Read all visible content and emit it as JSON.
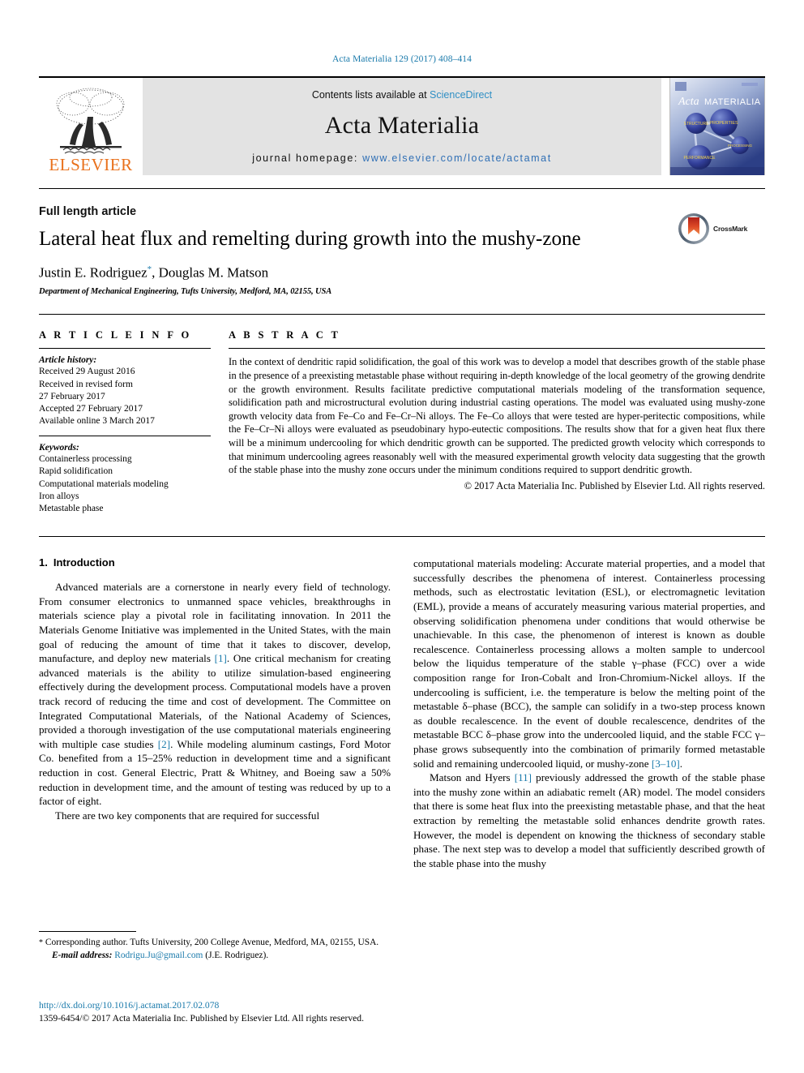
{
  "running_head": "Acta Materialia 129 (2017) 408–414",
  "banner": {
    "publisher_name": "ELSEVIER",
    "publisher_logo_icon": "elsevier-tree-icon",
    "contents_prefix": "Contents lists available at ",
    "contents_link": "ScienceDirect",
    "journal_title": "Acta Materialia",
    "homepage_prefix": "journal homepage: ",
    "homepage_url": "www.elsevier.com/locate/actamat",
    "cover_title_italic": "Acta",
    "cover_title_rest": "MATERIALIA",
    "cover_node_labels": [
      "STRUCTURE",
      "PROPERTIES",
      "PROCESSING",
      "PERFORMANCE"
    ]
  },
  "title_block": {
    "article_type": "Full length article",
    "title": "Lateral heat flux and remelting during growth into the mushy-zone",
    "authors_part1": "Justin E. Rodriguez",
    "author_star": "*",
    "authors_part2": ", Douglas M. Matson",
    "affiliation": "Department of Mechanical Engineering, Tufts University, Medford, MA, 02155, USA",
    "crossmark_label": "CrossMark"
  },
  "article_info": {
    "heading": "A R T I C L E   I N F O",
    "history_label": "Article history:",
    "history_lines": [
      "Received 29 August 2016",
      "Received in revised form",
      "27 February 2017",
      "Accepted 27 February 2017",
      "Available online 3 March 2017"
    ],
    "keywords_label": "Keywords:",
    "keywords": [
      "Containerless processing",
      "Rapid solidification",
      "Computational materials modeling",
      "Iron alloys",
      "Metastable phase"
    ]
  },
  "abstract": {
    "heading": "A B S T R A C T",
    "text": "In the context of dendritic rapid solidification, the goal of this work was to develop a model that describes growth of the stable phase in the presence of a preexisting metastable phase without requiring in-depth knowledge of the local geometry of the growing dendrite or the growth environment. Results facilitate predictive computational materials modeling of the transformation sequence, solidification path and microstructural evolution during industrial casting operations. The model was evaluated using mushy-zone growth velocity data from Fe–Co and Fe–Cr–Ni alloys. The Fe–Co alloys that were tested are hyper-peritectic compositions, while the Fe–Cr–Ni alloys were evaluated as pseudobinary hypo-eutectic compositions. The results show that for a given heat flux there will be a minimum undercooling for which dendritic growth can be supported. The predicted growth velocity which corresponds to that minimum undercooling agrees reasonably well with the measured experimental growth velocity data suggesting that the growth of the stable phase into the mushy zone occurs under the minimum conditions required to support dendritic growth.",
    "copyright": "© 2017 Acta Materialia Inc. Published by Elsevier Ltd. All rights reserved."
  },
  "introduction": {
    "number": "1.",
    "heading": "Introduction",
    "left_p1_a": "Advanced materials are a cornerstone in nearly every field of technology. From consumer electronics to unmanned space vehicles, breakthroughs in materials science play a pivotal role in facilitating innovation. In 2011 the Materials Genome Initiative was implemented in the United States, with the main goal of reducing the amount of time that it takes to discover, develop, manufacture, and deploy new materials ",
    "left_p1_ref1": "[1]",
    "left_p1_b": ". One critical mechanism for creating advanced materials is the ability to utilize simulation-based engineering effectively during the development process. Computational models have a proven track record of reducing the time and cost of development. The Committee on Integrated Computational Materials, of the National Academy of Sciences, provided a thorough investigation of the use computational materials engineering with multiple case studies ",
    "left_p1_ref2": "[2]",
    "left_p1_c": ". While modeling aluminum castings, Ford Motor Co. benefited from a 15–25% reduction in development time and a significant reduction in cost. General Electric, Pratt & Whitney, and Boeing saw a 50% reduction in development time, and the amount of testing was reduced by up to a factor of eight.",
    "left_p2": "There are two key components that are required for successful",
    "right_p1": "computational materials modeling: Accurate material properties, and a model that successfully describes the phenomena of interest. Containerless processing methods, such as electrostatic levitation (ESL), or electromagnetic levitation (EML), provide a means of accurately measuring various material properties, and observing solidification phenomena under conditions that would otherwise be unachievable. In this case, the phenomenon of interest is known as double recalescence. Containerless processing allows a molten sample to undercool below the liquidus temperature of the stable γ–phase (FCC) over a wide composition range for Iron-Cobalt and Iron-Chromium-Nickel alloys. If the undercooling is sufficient, i.e. the temperature is below the melting point of the metastable δ–phase (BCC), the sample can solidify in a two-step process known as double recalescence. In the event of double recalescence, dendrites of the metastable BCC δ–phase grow into the undercooled liquid, and the stable FCC γ–phase grows subsequently into the combination of primarily formed metastable solid and remaining undercooled liquid, or mushy-zone ",
    "right_p1_ref": "[3–10]",
    "right_p1_end": ".",
    "right_p2_a": "Matson and Hyers ",
    "right_p2_ref": "[11]",
    "right_p2_b": " previously addressed the growth of the stable phase into the mushy zone within an adiabatic remelt (AR) model. The model considers that there is some heat flux into the preexisting metastable phase, and that the heat extraction by remelting the metastable solid enhances dendrite growth rates. However, the model is dependent on knowing the thickness of secondary stable phase. The next step was to develop a model that sufficiently described growth of the stable phase into the mushy"
  },
  "footnote": {
    "star": "*",
    "corresponding": " Corresponding author. Tufts University, 200 College Avenue, Medford, MA, 02155, USA.",
    "email_label": "E-mail address:",
    "email": "Rodrigu.Ju@gmail.com",
    "email_owner": "(J.E. Rodriguez)."
  },
  "doi_block": {
    "doi_url": "http://dx.doi.org/10.1016/j.actamat.2017.02.078",
    "issn_line": "1359-6454/© 2017 Acta Materialia Inc. Published by Elsevier Ltd. All rights reserved."
  },
  "colors": {
    "link_blue": "#1a7aab",
    "sciencedirect_blue": "#2f8fc4",
    "elsevier_orange": "#E9711C",
    "banner_grey": "#e3e3e3",
    "crossmark_red": "#cc2b1d"
  }
}
